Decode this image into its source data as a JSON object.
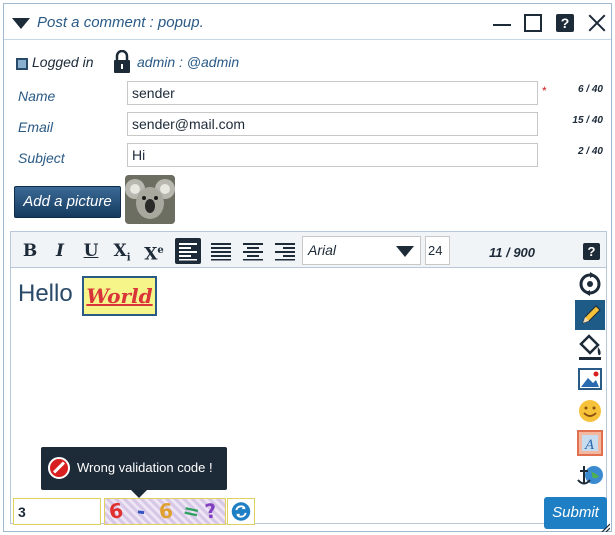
{
  "window": {
    "title": "Post a comment : popup."
  },
  "user": {
    "logged_label": "Logged in",
    "name": "admin : @admin"
  },
  "form": {
    "name_label": "Name",
    "name_value": "sender",
    "name_count": "6 / 40",
    "required_mark": "*",
    "email_label": "Email",
    "email_value": "sender@mail.com",
    "email_count": "15 / 40",
    "subject_label": "Subject",
    "subject_value": "Hi",
    "subject_count": "2 / 40",
    "add_picture_label": "Add a picture"
  },
  "editor": {
    "toolbar": {
      "bold": "B",
      "italic": "I",
      "underline": "U",
      "subscript": "X",
      "subscript_sub": "i",
      "superscript": "X",
      "superscript_sup": "e",
      "font": "Arial",
      "size": "24",
      "char_count": "11 / 900",
      "help": "?"
    },
    "content": {
      "hello": "Hello",
      "world": "World"
    }
  },
  "validation": {
    "error_message": "Wrong validation code !",
    "code_value": "3",
    "captcha_text": [
      "6",
      "-",
      "6",
      "=",
      "?"
    ],
    "captcha_colors": [
      "#e03030",
      "#3050c0",
      "#e0a030",
      "#30a060",
      "#8040c0"
    ]
  },
  "actions": {
    "submit_label": "Submit"
  },
  "colors": {
    "accent": "#1e5b86",
    "submit": "#1e7fc4",
    "error": "#d82020"
  }
}
